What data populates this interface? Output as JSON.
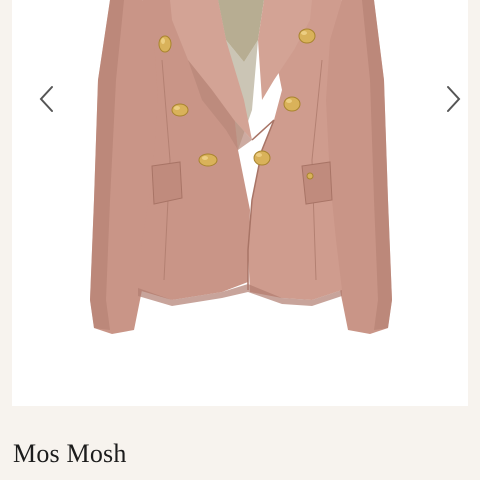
{
  "product": {
    "brand": "Mos Mosh",
    "image_description_icon": "pink-double-breasted-blazer-image"
  },
  "carousel": {
    "prev_icon": "chevron-left-icon",
    "next_icon": "chevron-right-icon"
  },
  "colors": {
    "background": "#f7f3ee",
    "card": "#ffffff",
    "blazer": "#c99587",
    "blazer_shadow": "#b17d70",
    "buttons": "#d9b25a",
    "lining": "#b7ad92",
    "text": "#1c1c1c",
    "arrow": "#555555"
  }
}
